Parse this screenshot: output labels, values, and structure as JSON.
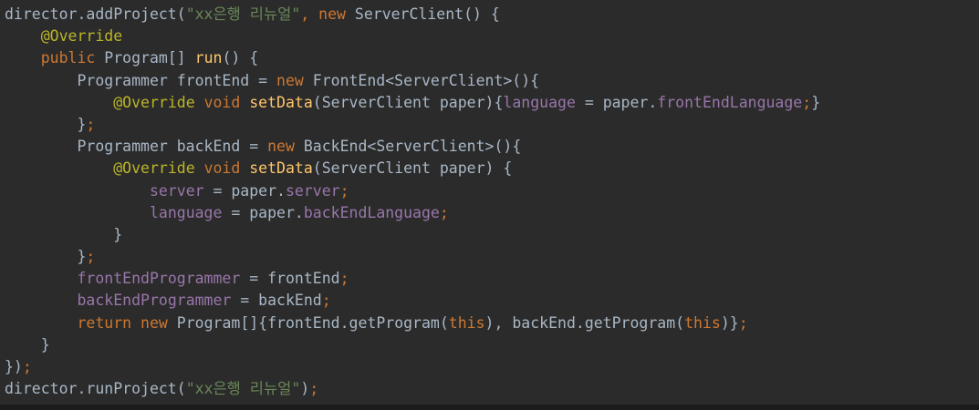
{
  "colors": {
    "background": "#2b2b2b",
    "default": "#a9b7c6",
    "string": "#6a8759",
    "keyword": "#cc7832",
    "annotation": "#bbb529",
    "method": "#ffc66d",
    "field": "#9876aa"
  },
  "code": {
    "lines": [
      [
        [
          "director.addProject(",
          "default"
        ],
        [
          "\"xx은행 리뉴얼\"",
          "string"
        ],
        [
          ", ",
          "keyword"
        ],
        [
          "new ",
          "keyword"
        ],
        [
          "ServerClient() {",
          "default"
        ]
      ],
      [
        [
          "    ",
          "default"
        ],
        [
          "@Override",
          "annotation"
        ]
      ],
      [
        [
          "    ",
          "default"
        ],
        [
          "public ",
          "keyword"
        ],
        [
          "Program[] ",
          "default"
        ],
        [
          "run",
          "method"
        ],
        [
          "() {",
          "default"
        ]
      ],
      [
        [
          "        Programmer frontEnd = ",
          "default"
        ],
        [
          "new ",
          "keyword"
        ],
        [
          "FrontEnd<ServerClient>(){",
          "default"
        ]
      ],
      [
        [
          "            ",
          "default"
        ],
        [
          "@Override ",
          "annotation"
        ],
        [
          "void ",
          "keyword"
        ],
        [
          "setData",
          "method"
        ],
        [
          "(ServerClient paper){",
          "default"
        ],
        [
          "language",
          "field"
        ],
        [
          " = paper.",
          "default"
        ],
        [
          "frontEndLanguage",
          "field"
        ],
        [
          ";",
          "keyword"
        ],
        [
          "}",
          "default"
        ]
      ],
      [
        [
          "        }",
          "default"
        ],
        [
          ";",
          "keyword"
        ]
      ],
      [
        [
          "        Programmer backEnd = ",
          "default"
        ],
        [
          "new ",
          "keyword"
        ],
        [
          "BackEnd<ServerClient>(){",
          "default"
        ]
      ],
      [
        [
          "            ",
          "default"
        ],
        [
          "@Override ",
          "annotation"
        ],
        [
          "void ",
          "keyword"
        ],
        [
          "setData",
          "method"
        ],
        [
          "(ServerClient paper) {",
          "default"
        ]
      ],
      [
        [
          "                ",
          "default"
        ],
        [
          "server",
          "field"
        ],
        [
          " = paper.",
          "default"
        ],
        [
          "server",
          "field"
        ],
        [
          ";",
          "keyword"
        ]
      ],
      [
        [
          "                ",
          "default"
        ],
        [
          "language",
          "field"
        ],
        [
          " = paper.",
          "default"
        ],
        [
          "backEndLanguage",
          "field"
        ],
        [
          ";",
          "keyword"
        ]
      ],
      [
        [
          "            }",
          "default"
        ]
      ],
      [
        [
          "        }",
          "default"
        ],
        [
          ";",
          "keyword"
        ]
      ],
      [
        [
          "        ",
          "default"
        ],
        [
          "frontEndProgrammer",
          "field"
        ],
        [
          " = frontEnd",
          "default"
        ],
        [
          ";",
          "keyword"
        ]
      ],
      [
        [
          "        ",
          "default"
        ],
        [
          "backEndProgrammer",
          "field"
        ],
        [
          " = backEnd",
          "default"
        ],
        [
          ";",
          "keyword"
        ]
      ],
      [
        [
          "        ",
          "default"
        ],
        [
          "return ",
          "keyword"
        ],
        [
          "new ",
          "keyword"
        ],
        [
          "Program[]{frontEnd.getProgram(",
          "default"
        ],
        [
          "this",
          "keyword"
        ],
        [
          "), backEnd.getProgram(",
          "default"
        ],
        [
          "this",
          "keyword"
        ],
        [
          ")}",
          "default"
        ],
        [
          ";",
          "keyword"
        ]
      ],
      [
        [
          "    }",
          "default"
        ]
      ],
      [
        [
          "})",
          "default"
        ],
        [
          ";",
          "keyword"
        ]
      ],
      [
        [
          "director.runProject(",
          "default"
        ],
        [
          "\"xx은행 리뉴얼\"",
          "string"
        ],
        [
          ")",
          "default"
        ],
        [
          ";",
          "keyword"
        ]
      ]
    ]
  }
}
